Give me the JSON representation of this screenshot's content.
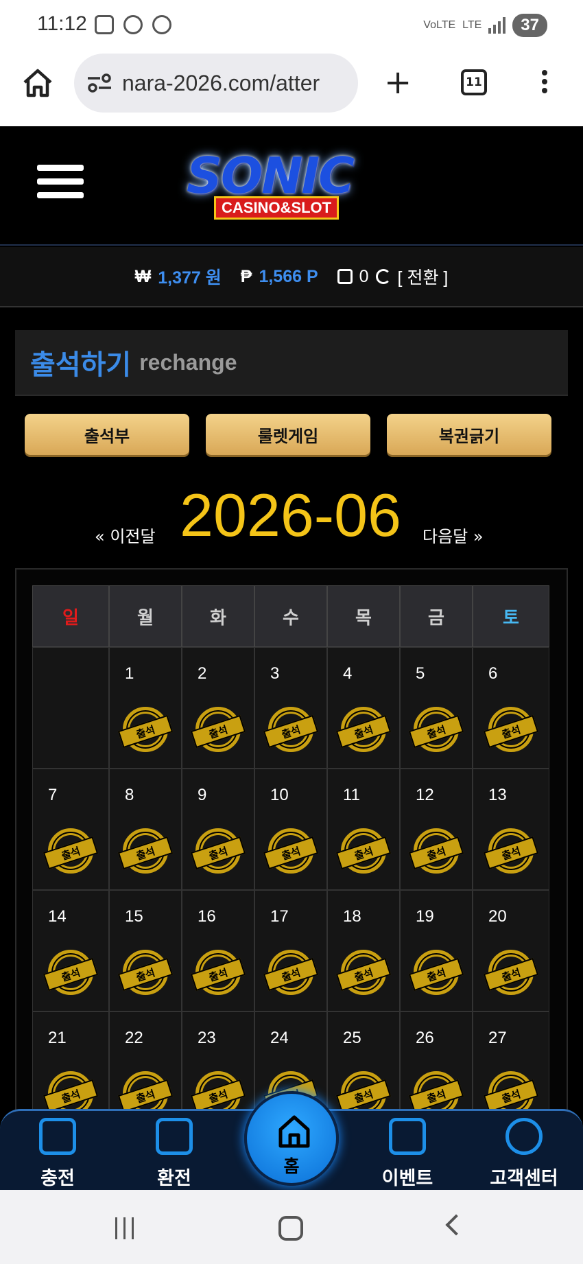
{
  "statusbar": {
    "time": "11:12",
    "network": "LTE",
    "battery": "37"
  },
  "browser": {
    "url": "nara-2026.com/atter",
    "tab_count": "11"
  },
  "header": {
    "logo_main": "SONIC",
    "logo_sub": "CASINO&SLOT"
  },
  "balance": {
    "won_symbol": "₩",
    "won_amount": "1,377 원",
    "point_symbol": "₱",
    "point_amount": "1,566 P",
    "count": "0",
    "switch_label": "[ 전환 ]"
  },
  "section": {
    "title_ko": "출석하기",
    "title_en": "rechange"
  },
  "buttons": {
    "attendance": "출석부",
    "roulette": "룰렛게임",
    "lottery": "복권긁기"
  },
  "calendar": {
    "month": "2026-06",
    "prev": "« 이전달",
    "next": "다음달 »",
    "weekdays": [
      "일",
      "월",
      "화",
      "수",
      "목",
      "금",
      "토"
    ],
    "stamp": "출석",
    "days": [
      "",
      "1",
      "2",
      "3",
      "4",
      "5",
      "6",
      "7",
      "8",
      "9",
      "10",
      "11",
      "12",
      "13",
      "14",
      "15",
      "16",
      "17",
      "18",
      "19",
      "20",
      "21",
      "22",
      "23",
      "24",
      "25",
      "26",
      "27"
    ]
  },
  "bottomnav": {
    "charge": "충전",
    "exchange": "환전",
    "home": "홈",
    "event": "이벤트",
    "support": "고객센터"
  },
  "colors": {
    "accent_blue": "#3b8be8",
    "gold": "#f4c418",
    "sunday": "#e11b1b",
    "saturday": "#47b8f2"
  }
}
